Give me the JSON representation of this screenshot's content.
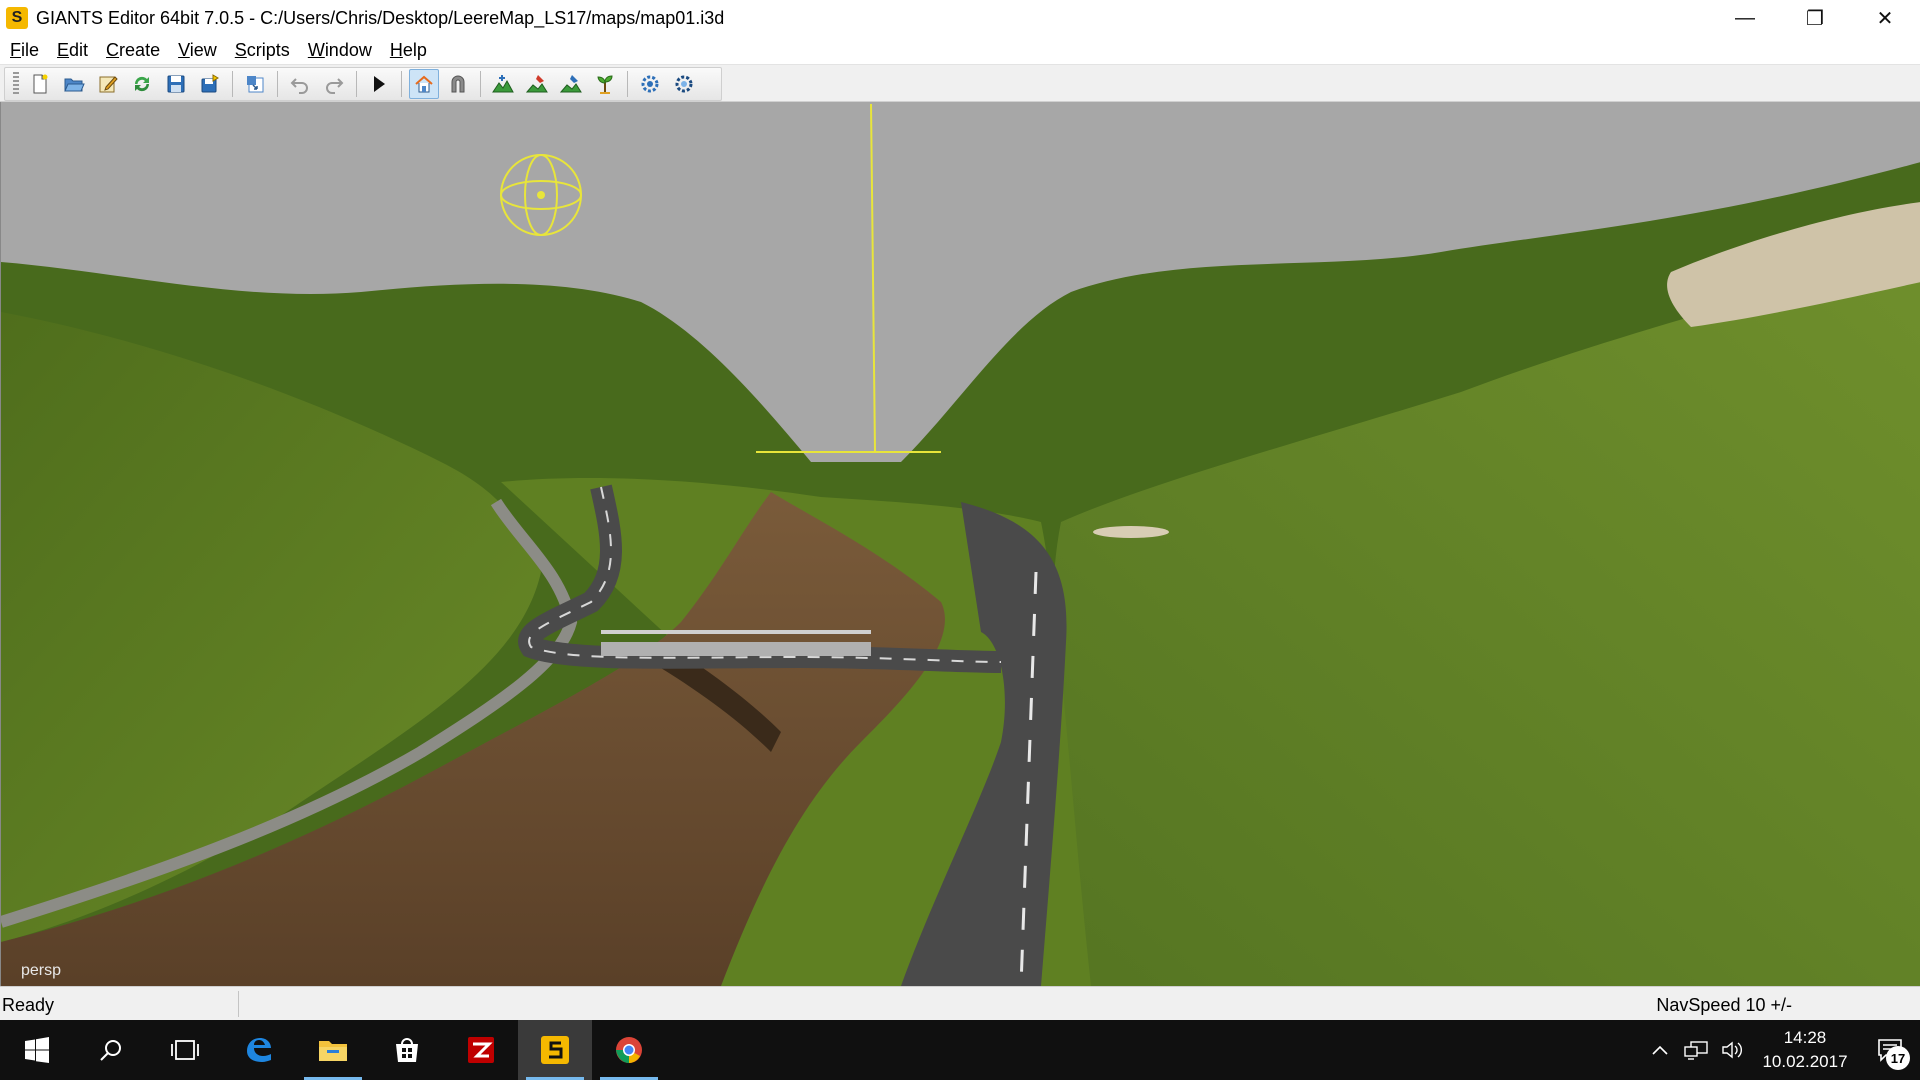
{
  "window": {
    "title": "GIANTS Editor 64bit 7.0.5 - C:/Users/Chris/Desktop/LeereMap_LS17/maps/map01.i3d",
    "app_icon_glyph": "S",
    "controls": {
      "minimize": "—",
      "restore": "❐",
      "close": "✕"
    }
  },
  "menu": [
    {
      "label": "File",
      "accel": "F",
      "rest": "ile"
    },
    {
      "label": "Edit",
      "accel": "E",
      "rest": "dit"
    },
    {
      "label": "Create",
      "accel": "C",
      "rest": "reate"
    },
    {
      "label": "View",
      "accel": "V",
      "rest": "iew"
    },
    {
      "label": "Scripts",
      "accel": "S",
      "rest": "cripts"
    },
    {
      "label": "Window",
      "accel": "W",
      "rest": "indow"
    },
    {
      "label": "Help",
      "accel": "H",
      "rest": "elp"
    }
  ],
  "toolbar": {
    "buttons": [
      {
        "name": "new-file-icon"
      },
      {
        "name": "open-file-icon"
      },
      {
        "name": "edit-file-icon"
      },
      {
        "name": "refresh-icon"
      },
      {
        "name": "save-icon"
      },
      {
        "name": "save-as-icon"
      },
      {
        "name": "import-icon"
      },
      {
        "name": "undo-icon"
      },
      {
        "name": "redo-icon"
      },
      {
        "name": "play-icon"
      },
      {
        "name": "home-icon",
        "active": true
      },
      {
        "name": "magnet-icon"
      },
      {
        "name": "terrain-sculpt-icon"
      },
      {
        "name": "terrain-paint-icon"
      },
      {
        "name": "foliage-paint-icon"
      },
      {
        "name": "plant-icon"
      },
      {
        "name": "settings-gear-icon"
      },
      {
        "name": "settings-gear-alt-icon"
      }
    ]
  },
  "viewport": {
    "camera_label": "persp",
    "colors": {
      "sky": "#a7a7a7",
      "grass": "#5a7a22",
      "dirt": "#6b4f33",
      "road": "#4a4a4a",
      "gizmo": "#e8e53a"
    }
  },
  "status": {
    "left": "Ready",
    "right": "NavSpeed 10 +/-"
  },
  "taskbar": {
    "apps": [
      {
        "name": "start-button-icon"
      },
      {
        "name": "search-icon"
      },
      {
        "name": "task-view-icon"
      },
      {
        "name": "edge-browser-icon"
      },
      {
        "name": "file-explorer-icon",
        "running": true
      },
      {
        "name": "store-icon"
      },
      {
        "name": "filezilla-icon"
      },
      {
        "name": "giants-editor-icon",
        "running": true,
        "active": true
      },
      {
        "name": "chrome-icon",
        "running": true
      }
    ],
    "tray": {
      "time": "14:28",
      "date": "10.02.2017",
      "notification_count": "17"
    }
  }
}
